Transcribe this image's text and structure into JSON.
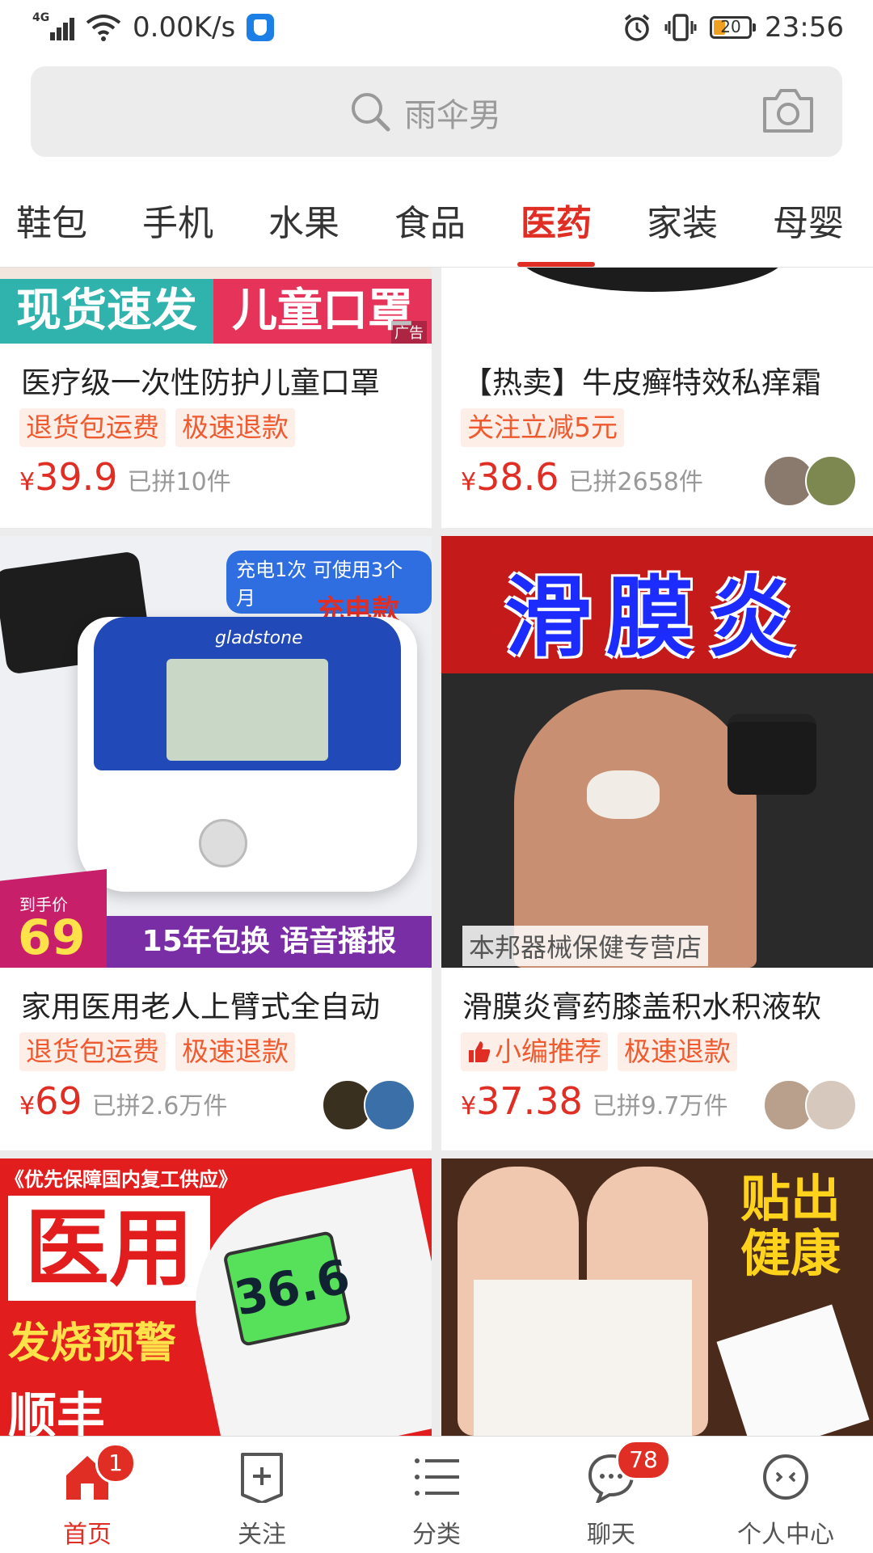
{
  "status_bar": {
    "network": "4G",
    "speed": "0.00K/s",
    "battery": "20",
    "time": "23:56"
  },
  "search": {
    "placeholder": "雨伞男"
  },
  "tabs": [
    {
      "label": "鞋包"
    },
    {
      "label": "手机"
    },
    {
      "label": "水果"
    },
    {
      "label": "食品"
    },
    {
      "label": "医药",
      "active": true
    },
    {
      "label": "家装"
    },
    {
      "label": "母婴"
    }
  ],
  "products": [
    {
      "banner_left": "现货速发",
      "banner_right": "儿童口罩",
      "ad": "广告",
      "title": "医疗级一次性防护儿童口罩",
      "tags": [
        "退货包运费",
        "极速退款"
      ],
      "currency": "¥",
      "price": "39.9",
      "sold": "已拼10件"
    },
    {
      "title": "【热卖】牛皮癣特效私痒霜",
      "tags": [
        "关注立减5元"
      ],
      "currency": "¥",
      "price": "38.6",
      "sold": "已拼2658件"
    },
    {
      "img_top_label": "充电1次 可使用3个月",
      "img_sub_label": "充电款",
      "brand": "gladstone",
      "promo_small": "到手价",
      "promo_price": "69",
      "banner_bottom": "15年包换 语音播报",
      "title": "家用医用老人上臂式全自动",
      "tags": [
        "退货包运费",
        "极速退款"
      ],
      "currency": "¥",
      "price": "69",
      "sold": "已拼2.6万件"
    },
    {
      "img_big_text": "滑膜炎",
      "shop": "本邦器械保健专营店",
      "title": "滑膜炎膏药膝盖积水积液软",
      "tags": [
        "小编推荐",
        "极速退款"
      ],
      "currency": "¥",
      "price": "37.38",
      "sold": "已拼9.7万件"
    },
    {
      "img_top_label": "《优先保障国内复工供应》",
      "img_big_text": "医用",
      "img_sub_label": "发烧预警",
      "img_bottom_text": "顺丰",
      "reading": "36.6"
    },
    {
      "img_big_text_1": "贴出",
      "img_big_text_2": "健康"
    }
  ],
  "bottom_nav": [
    {
      "label": "首页",
      "badge": "1",
      "active": true
    },
    {
      "label": "关注"
    },
    {
      "label": "分类"
    },
    {
      "label": "聊天",
      "badge": "78"
    },
    {
      "label": "个人中心"
    }
  ],
  "colors": {
    "accent": "#e02e24",
    "tag_text": "#ef5a2f",
    "tag_bg": "#fdeee8"
  }
}
